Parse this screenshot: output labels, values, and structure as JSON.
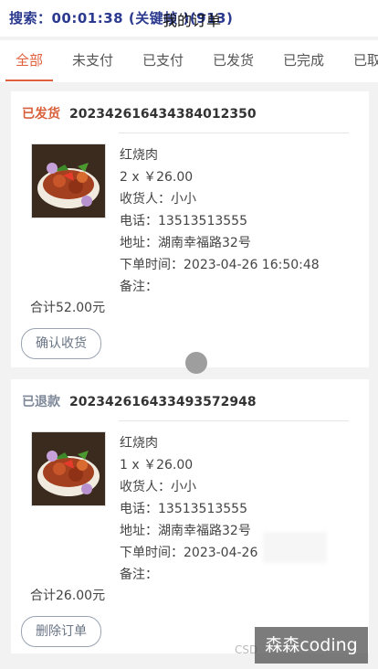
{
  "header": {
    "search_overlay": "搜索：00:01:38 (关键帧 )(913)",
    "title": "我的订单"
  },
  "tabs": [
    {
      "label": "全部",
      "active": true
    },
    {
      "label": "未支付"
    },
    {
      "label": "已支付"
    },
    {
      "label": "已发货"
    },
    {
      "label": "已完成"
    },
    {
      "label": "已取"
    }
  ],
  "orders": [
    {
      "status": "已发货",
      "status_color": "#d9603b",
      "order_no": "202342616434384012350",
      "item_name": "红烧肉",
      "qty_price": "2 x ￥26.00",
      "receiver": "收货人：小小",
      "phone": "电话：13513513555",
      "address": "地址：湖南幸福路32号",
      "order_time": "下单时间：2023-04-26 16:50:48",
      "remark": "备注：",
      "total": "合计52.00元",
      "action": "确认收货"
    },
    {
      "status": "已退款",
      "status_color": "#7e8899",
      "order_no": "202342616433493572948",
      "item_name": "红烧肉",
      "qty_price": "1 x ￥26.00",
      "receiver": "收货人：小小",
      "phone": "电话：13513513555",
      "address": "地址：湖南幸福路32号",
      "order_time": "下单时间：2023-04-26",
      "remark": "备注：",
      "total": "合计26.00元",
      "action": "删除订单"
    }
  ],
  "watermark": {
    "label": "森森coding",
    "faint": "CSD"
  },
  "icons": {
    "thumb": "food-image",
    "scroll": "scroll-indicator"
  }
}
